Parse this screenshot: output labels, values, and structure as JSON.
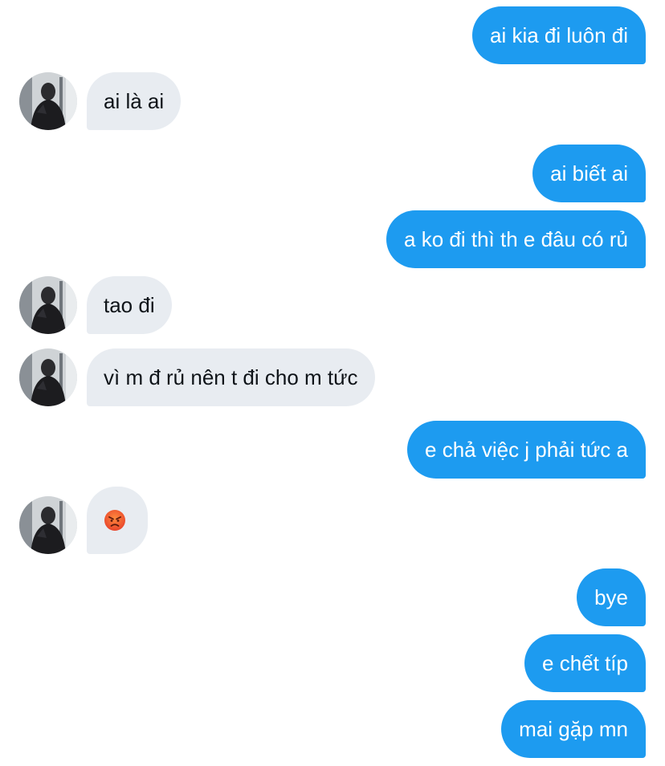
{
  "conversation": {
    "messages": [
      {
        "from": "me",
        "text": "ai kia đi luôn đi"
      },
      {
        "from": "them",
        "text": "ai là ai"
      },
      {
        "from": "me",
        "text": "ai biết ai"
      },
      {
        "from": "me",
        "text": "a ko đi thì th e đâu có rủ"
      },
      {
        "from": "them",
        "text": "tao đi"
      },
      {
        "from": "them",
        "text": "vì m đ rủ nên t đi cho m tức"
      },
      {
        "from": "me",
        "text": "e chả việc j phải tức a"
      },
      {
        "from": "them",
        "emoji": "angry-face"
      },
      {
        "from": "me",
        "text": "bye"
      },
      {
        "from": "me",
        "text": "e chết típ"
      },
      {
        "from": "me",
        "text": "mai gặp mn"
      }
    ]
  },
  "colors": {
    "outgoing_bubble": "#1d9bf0",
    "incoming_bubble": "#e8ecf1",
    "incoming_text": "#0f1419",
    "background": "#ffffff"
  }
}
